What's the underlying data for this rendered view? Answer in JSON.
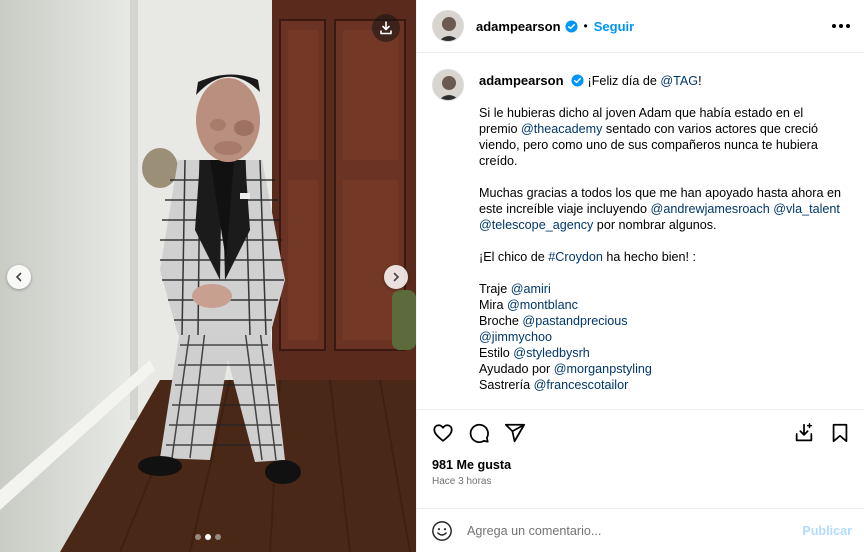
{
  "post": {
    "author": "adampearson",
    "follow_label": "Seguir",
    "dot_separator": "•",
    "verified": true
  },
  "caption": {
    "author": "adampearson",
    "line1_text": "¡Feliz día de ",
    "line1_mention": "@TAG",
    "line1_end": "!",
    "p2_a": "Si le hubieras dicho al joven Adam que había estado en el premio ",
    "p2_mention": "@theacademy",
    "p2_b": " sentado con varios actores que creció viendo, pero como uno de sus compañeros nunca te hubiera creído.",
    "p3_a": "Muchas gracias a todos los que me han apoyado hasta ahora en este increíble viaje incluyendo ",
    "p3_m1": "@andrewjamesroach",
    "p3_m2": "@vla_talent",
    "p3_m3": "@telescope_agency",
    "p3_b": " por nombrar algunos.",
    "p4_a": "¡El chico de ",
    "p4_tag": "#Croydon",
    "p4_b": " ha hecho bien! :",
    "credits": [
      {
        "label": "Traje ",
        "mention": "@amiri"
      },
      {
        "label": "Mira ",
        "mention": "@montblanc"
      },
      {
        "label": "Broche ",
        "mention": "@pastandprecious"
      },
      {
        "label": "",
        "mention": "@jimmychoo"
      },
      {
        "label": "Estilo ",
        "mention": "@styledbysrh"
      },
      {
        "label": "Ayudado por ",
        "mention": "@morganpstyling"
      },
      {
        "label": "Sastrería ",
        "mention": "@francescotailor"
      }
    ]
  },
  "stats": {
    "likes": "981 Me gusta",
    "time": "Hace 3 horas"
  },
  "comment_box": {
    "placeholder": "Agrega un comentario...",
    "publish_label": "Publicar"
  },
  "carousel": {
    "count": 3,
    "active_index": 1
  },
  "icons": {
    "download": "download-icon",
    "prev": "chevron-left-icon",
    "next": "chevron-right-icon",
    "like": "heart-icon",
    "comment": "comment-icon",
    "share": "send-icon",
    "add_to_collection": "download-tray-icon",
    "save": "bookmark-icon",
    "emoji": "smiley-icon",
    "more": "more-icon",
    "verified": "verified-badge-icon"
  },
  "colors": {
    "link": "#00376b",
    "follow": "#0095f6",
    "publish_disabled": "#b3dbff",
    "verified": "#0095f6"
  }
}
